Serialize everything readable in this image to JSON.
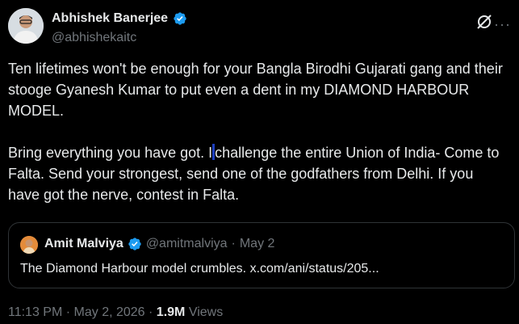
{
  "tweet": {
    "author": {
      "name": "Abhishek Banerjee",
      "handle": "@abhishekaitc",
      "verified": true
    },
    "paragraph1": "Ten lifetimes won't be enough for your Bangla Birodhi Gujarati gang and their stooge Gyanesh Kumar to put even a dent in my DIAMOND HARBOUR MODEL.",
    "paragraph2_a": "Bring everything you have got. I",
    "paragraph2_b": "challenge the entire Union of India- Come to Falta. Send your strongest, send one of the godfathers from Delhi. If you have got the nerve, contest in Falta."
  },
  "quote": {
    "author": {
      "name": "Amit Malviya",
      "handle": "@amitmalviya",
      "verified": true
    },
    "separator": "·",
    "date": "May 2",
    "text": "The Diamond Harbour model crumbles. x.com/ani/status/205..."
  },
  "meta": {
    "time": "11:13 PM · May 2, 2026 ·",
    "views_count": "1.9M",
    "views_label": "Views"
  },
  "icons": {
    "verified": "verified-badge-icon",
    "grok": "grok-icon",
    "more": "more-options-icon"
  },
  "colors": {
    "background": "#000000",
    "text": "#e7e9ea",
    "secondary": "#71767b",
    "verified": "#1d9bf0",
    "border": "#2f3336"
  }
}
